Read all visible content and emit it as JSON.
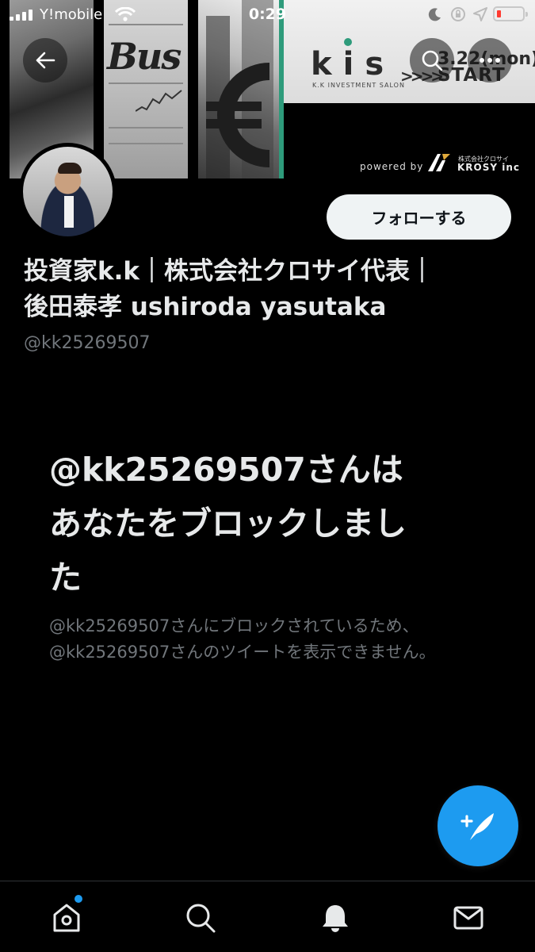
{
  "status_bar": {
    "carrier": "Y!mobile",
    "time": "0:29"
  },
  "banner": {
    "photo_text": "Bus",
    "logo_text": "kis",
    "logo_subtitle": "K.K INVESTMENT SALON",
    "arrows": ">>>>",
    "date_text": "3.22(mon)",
    "start_text": "START",
    "powered_by": "powered by",
    "company_small": "株式会社クロサイ",
    "company_name": "KROSY inc",
    "accent_color": "#2e9b7b"
  },
  "header": {
    "back_icon": "arrow-left-icon",
    "search_icon": "search-icon",
    "more_icon": "more-dots-icon"
  },
  "profile": {
    "display_name_line1": "投資家k.k｜株式会社クロサイ代表｜",
    "display_name_line2": "後田泰孝 ushiroda yasutaka",
    "handle": "@kk25269507",
    "follow_label": "フォローする"
  },
  "blocked": {
    "title_line1": "@kk25269507さんは",
    "title_line2": "あなたをブロックしまし",
    "title_line3": "た",
    "description": "@kk25269507さんにブロックされているため、@kk25269507さんのツイートを表示できません。"
  },
  "fab": {
    "icon": "compose-tweet-icon",
    "color": "#1d9bf0"
  },
  "tabbar": {
    "items": [
      {
        "name": "home",
        "icon": "home-icon",
        "has_badge": true
      },
      {
        "name": "search",
        "icon": "search-icon"
      },
      {
        "name": "notifications",
        "icon": "bell-icon"
      },
      {
        "name": "messages",
        "icon": "mail-icon"
      }
    ]
  }
}
